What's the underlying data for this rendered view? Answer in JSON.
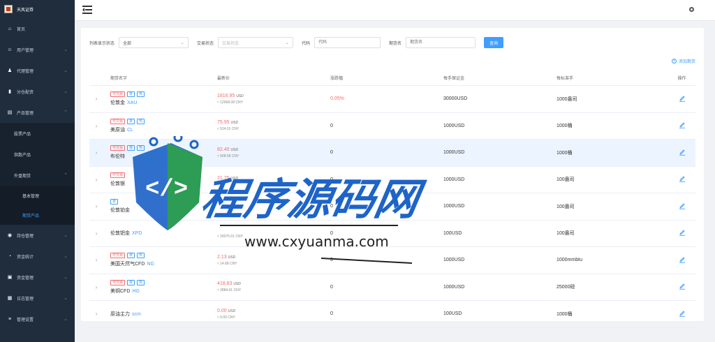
{
  "app": {
    "title": "天风证券"
  },
  "sidebar": {
    "items": [
      {
        "label": "首页",
        "icon": "home-icon",
        "has_children": false
      },
      {
        "label": "用户管理",
        "icon": "user-icon",
        "has_children": true
      },
      {
        "label": "代理管理",
        "icon": "agent-icon",
        "has_children": true
      },
      {
        "label": "分仓配资",
        "icon": "chart-icon",
        "has_children": true
      },
      {
        "label": "产品管理",
        "icon": "product-icon",
        "has_children": true,
        "expanded": true
      }
    ],
    "product_children": [
      "股票产品",
      "指数产品"
    ],
    "futures_group": {
      "label": "外盘期货",
      "children": [
        "基本管理",
        "期货产品"
      ],
      "active": "期货产品"
    },
    "items_after": [
      {
        "label": "持仓管理",
        "icon": "position-icon"
      },
      {
        "label": "资金统计",
        "icon": "stats-icon"
      },
      {
        "label": "资金管理",
        "icon": "money-icon"
      },
      {
        "label": "日志管理",
        "icon": "log-icon"
      },
      {
        "label": "管理设置",
        "icon": "settings-icon"
      }
    ]
  },
  "filters": {
    "list_status_label": "列表显示状态",
    "list_status_value": "全部",
    "trade_status_label": "交易状态",
    "trade_status_placeholder": "交易状态",
    "code_label": "代码",
    "code_placeholder": "代码",
    "name_label": "期货名",
    "name_placeholder": "期货名",
    "search_button": "查询",
    "add_link": "添加期货"
  },
  "table": {
    "headers": [
      "期货名字",
      "最新价",
      "涨跌幅",
      "每手保证金",
      "每标准手",
      "操作"
    ],
    "rows": [
      {
        "tags": [
          "可交易",
          "夜",
          "热"
        ],
        "name": "伦敦金",
        "code": "XAU",
        "price": "1816.95",
        "currency": "USD",
        "cny": "≈ 12668.08 CNY",
        "change": "0.05%",
        "change_red": true,
        "margin": "30000USD",
        "unit": "1000盎司"
      },
      {
        "tags": [
          "可交易",
          "夜",
          "热"
        ],
        "name": "美原油",
        "code": "CL",
        "price": "75.95",
        "currency": "USD",
        "cny": "≈ 524.01 CNY",
        "change": "0",
        "change_red": false,
        "margin": "1000USD",
        "unit": "1000桶"
      },
      {
        "tags": [
          "可交易",
          "夜",
          "热"
        ],
        "name": "布伦特",
        "code": "",
        "price": "82.40",
        "currency": "USD",
        "cny": "≈ 568.58 CNY",
        "change": "0",
        "change_red": false,
        "margin": "1000USD",
        "unit": "1000桶"
      },
      {
        "tags": [
          "可交易"
        ],
        "name": "伦敦银",
        "code": "",
        "price": "21.75",
        "currency": "USD",
        "cny": "",
        "change": "0",
        "change_red": false,
        "margin": "1000USD",
        "unit": "100盎司"
      },
      {
        "tags": [
          "夜"
        ],
        "name": "伦敦铂金",
        "code": "",
        "price": "",
        "currency": "",
        "cny": "",
        "change": "0",
        "change_red": false,
        "margin": "1000USD",
        "unit": "100盎司"
      },
      {
        "tags": [],
        "name": "伦敦钯金",
        "code": "XPD",
        "price": "",
        "currency": "",
        "cny": "≈ 18075.01 CNY",
        "change": "0",
        "change_red": false,
        "margin": "100USD",
        "unit": "100盎司"
      },
      {
        "tags": [
          "可交易",
          "夜",
          "热"
        ],
        "name": "美国天然气CFD",
        "code": "NG",
        "price": "2.13",
        "currency": "USD",
        "cny": "≈ 14.68 CNY",
        "change": "0",
        "change_red": false,
        "margin": "1000USD",
        "unit": "1000mmbtu"
      },
      {
        "tags": [
          "可交易",
          "夜",
          "热"
        ],
        "name": "美铜CFD",
        "code": "HG",
        "price": "418.83",
        "currency": "USD",
        "cny": "≈ 2884.41 CNY",
        "change": "0",
        "change_red": false,
        "margin": "1000USD",
        "unit": "25000磅"
      },
      {
        "tags": [],
        "name": "原油主力",
        "code": "scm",
        "price": "0.00",
        "currency": "USD",
        "cny": "≈ 0.00 CNY",
        "change": "0",
        "change_red": false,
        "margin": "100USD",
        "unit": "1000桶"
      }
    ]
  },
  "watermark": {
    "title": "程序源码网",
    "url": "www.cxyuanma.com"
  },
  "colors": {
    "sidebar_bg": "#1f2d3d",
    "accent": "#409eff",
    "price_red": "#f56c6c",
    "tag_orange": "#e6a23c"
  }
}
